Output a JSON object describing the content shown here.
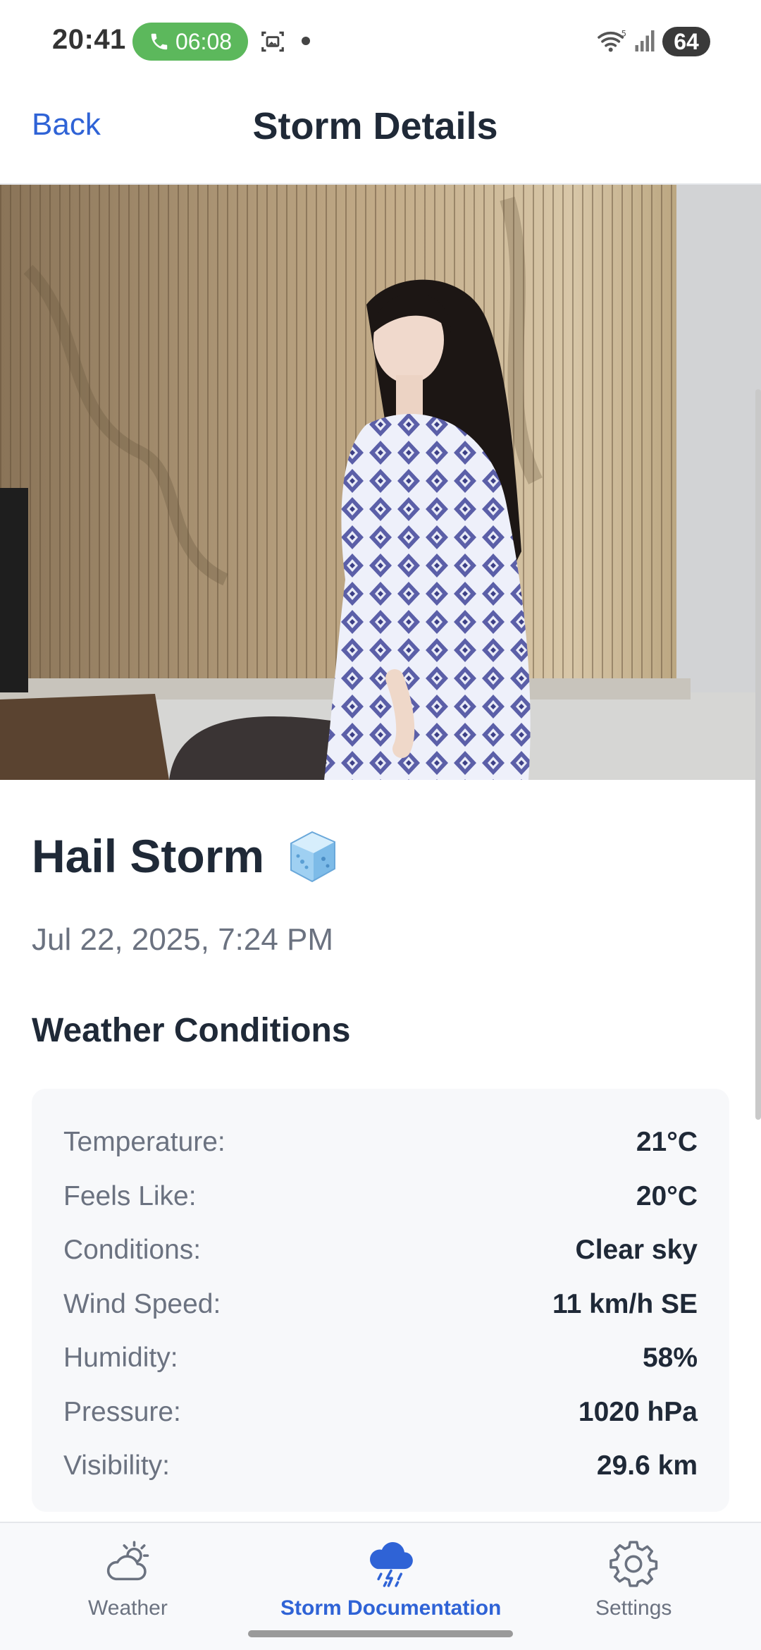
{
  "status_bar": {
    "time": "20:41",
    "call_timer": "06:08",
    "battery_level": "64"
  },
  "header": {
    "back_label": "Back",
    "title": "Storm Details"
  },
  "storm": {
    "name": "Hail Storm",
    "emoji_icon": "ice-cube-icon",
    "date": "Jul 22, 2025, 7:24 PM"
  },
  "weather_section": {
    "title": "Weather Conditions",
    "rows": [
      {
        "label": "Temperature:",
        "value": "21°C"
      },
      {
        "label": "Feels Like:",
        "value": "20°C"
      },
      {
        "label": "Conditions:",
        "value": "Clear sky"
      },
      {
        "label": "Wind Speed:",
        "value": "11 km/h SE"
      },
      {
        "label": "Humidity:",
        "value": "58%"
      },
      {
        "label": "Pressure:",
        "value": "1020 hPa"
      },
      {
        "label": "Visibility:",
        "value": "29.6 km"
      }
    ]
  },
  "bottom_nav": {
    "items": [
      {
        "label": "Weather",
        "icon": "partly-cloudy-icon",
        "active": false
      },
      {
        "label": "Storm Documentation",
        "icon": "storm-cloud-icon",
        "active": true
      },
      {
        "label": "Settings",
        "icon": "gear-icon",
        "active": false
      }
    ]
  },
  "colors": {
    "accent": "#2f63d6",
    "call_green": "#5cb85c",
    "text_primary": "#1f2937",
    "text_secondary": "#6b7280",
    "card_bg": "#f7f8fa"
  }
}
